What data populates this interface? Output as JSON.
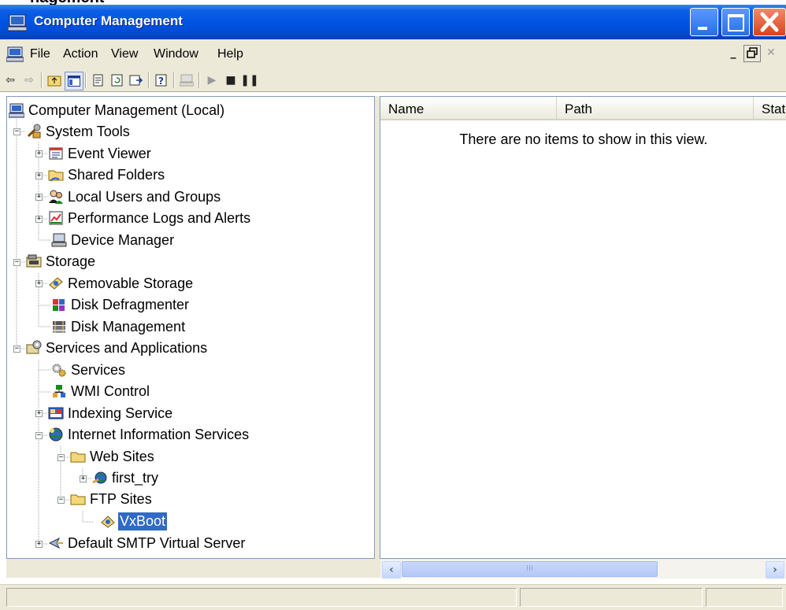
{
  "window": {
    "top_strip_text": "nagement",
    "title": "Computer Management"
  },
  "menu": {
    "items": [
      "File",
      "Action",
      "View",
      "Window",
      "Help"
    ]
  },
  "tree": {
    "nodes": [
      {
        "id": "root",
        "label": "Computer Management (Local)"
      },
      {
        "id": "system-tools",
        "label": "System Tools"
      },
      {
        "id": "event-viewer",
        "label": "Event Viewer"
      },
      {
        "id": "shared-folders",
        "label": "Shared Folders"
      },
      {
        "id": "local-users",
        "label": "Local Users and Groups"
      },
      {
        "id": "perf-logs",
        "label": "Performance Logs and Alerts"
      },
      {
        "id": "device-manager",
        "label": "Device Manager"
      },
      {
        "id": "storage",
        "label": "Storage"
      },
      {
        "id": "removable-storage",
        "label": "Removable Storage"
      },
      {
        "id": "disk-defrag",
        "label": "Disk Defragmenter"
      },
      {
        "id": "disk-mgmt",
        "label": "Disk Management"
      },
      {
        "id": "services-apps",
        "label": "Services and Applications"
      },
      {
        "id": "services",
        "label": "Services"
      },
      {
        "id": "wmi",
        "label": "WMI Control"
      },
      {
        "id": "indexing",
        "label": "Indexing Service"
      },
      {
        "id": "iis",
        "label": "Internet Information Services"
      },
      {
        "id": "web-sites",
        "label": "Web Sites"
      },
      {
        "id": "first-try",
        "label": "first_try"
      },
      {
        "id": "ftp-sites",
        "label": "FTP Sites"
      },
      {
        "id": "vxboot",
        "label": "VxBoot"
      },
      {
        "id": "smtp",
        "label": "Default SMTP Virtual Server"
      }
    ]
  },
  "list": {
    "columns": [
      "Name",
      "Path",
      "Stat"
    ],
    "empty_message": "There are no items to show in this view.",
    "scroll_grip": "III"
  },
  "colors": {
    "titlebar": "#0054e3",
    "selection": "#316ac5",
    "chrome": "#ece9d8"
  }
}
